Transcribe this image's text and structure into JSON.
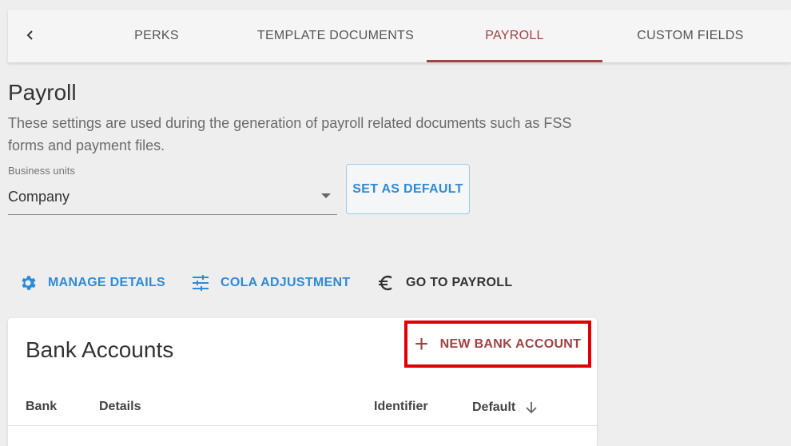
{
  "tabs": {
    "items": [
      {
        "label": "PERKS"
      },
      {
        "label": "TEMPLATE DOCUMENTS"
      },
      {
        "label": "PAYROLL"
      },
      {
        "label": "CUSTOM FIELDS"
      }
    ],
    "active": "PAYROLL"
  },
  "page": {
    "title": "Payroll",
    "description": "These settings are used during the generation of payroll related documents such as FSS forms and payment files."
  },
  "business_units": {
    "label": "Business units",
    "value": "Company",
    "set_default_label": "SET AS DEFAULT"
  },
  "actions": {
    "manage_details": "MANAGE DETAILS",
    "cola_adjustment": "COLA ADJUSTMENT",
    "go_to_payroll": "GO TO PAYROLL"
  },
  "bank_accounts": {
    "title": "Bank Accounts",
    "new_button": "NEW BANK ACCOUNT",
    "columns": [
      "Bank",
      "Details",
      "Identifier",
      "Default"
    ]
  },
  "colors": {
    "accent_red": "#a34242",
    "link_blue": "#2f8ad6",
    "highlight_box": "#e00000"
  },
  "icons": [
    "chevron-left-icon",
    "dropdown-caret-icon",
    "gear-icon",
    "sliders-icon",
    "euro-icon",
    "plus-icon",
    "arrow-down-icon"
  ]
}
